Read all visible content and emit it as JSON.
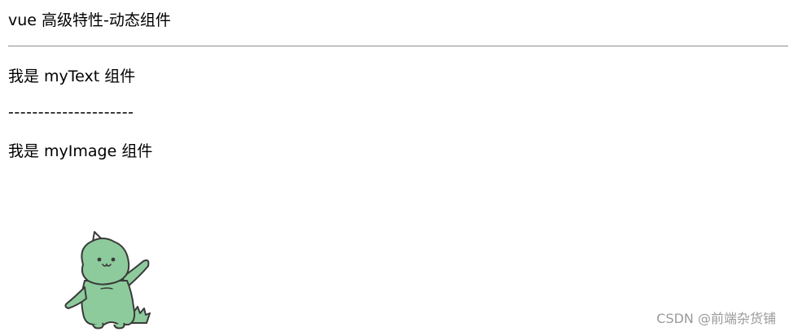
{
  "page": {
    "title": "vue 高级特性-动态组件"
  },
  "content": {
    "text_component_line": "我是 myText 组件",
    "separator_line": "---------------------",
    "image_component_line": "我是 myImage 组件"
  },
  "image": {
    "icon": "dinosaur-illustration",
    "body_color": "#8dcb9c",
    "outline_color": "#3a3a3a"
  },
  "watermark": {
    "text": "CSDN @前端杂货铺"
  }
}
